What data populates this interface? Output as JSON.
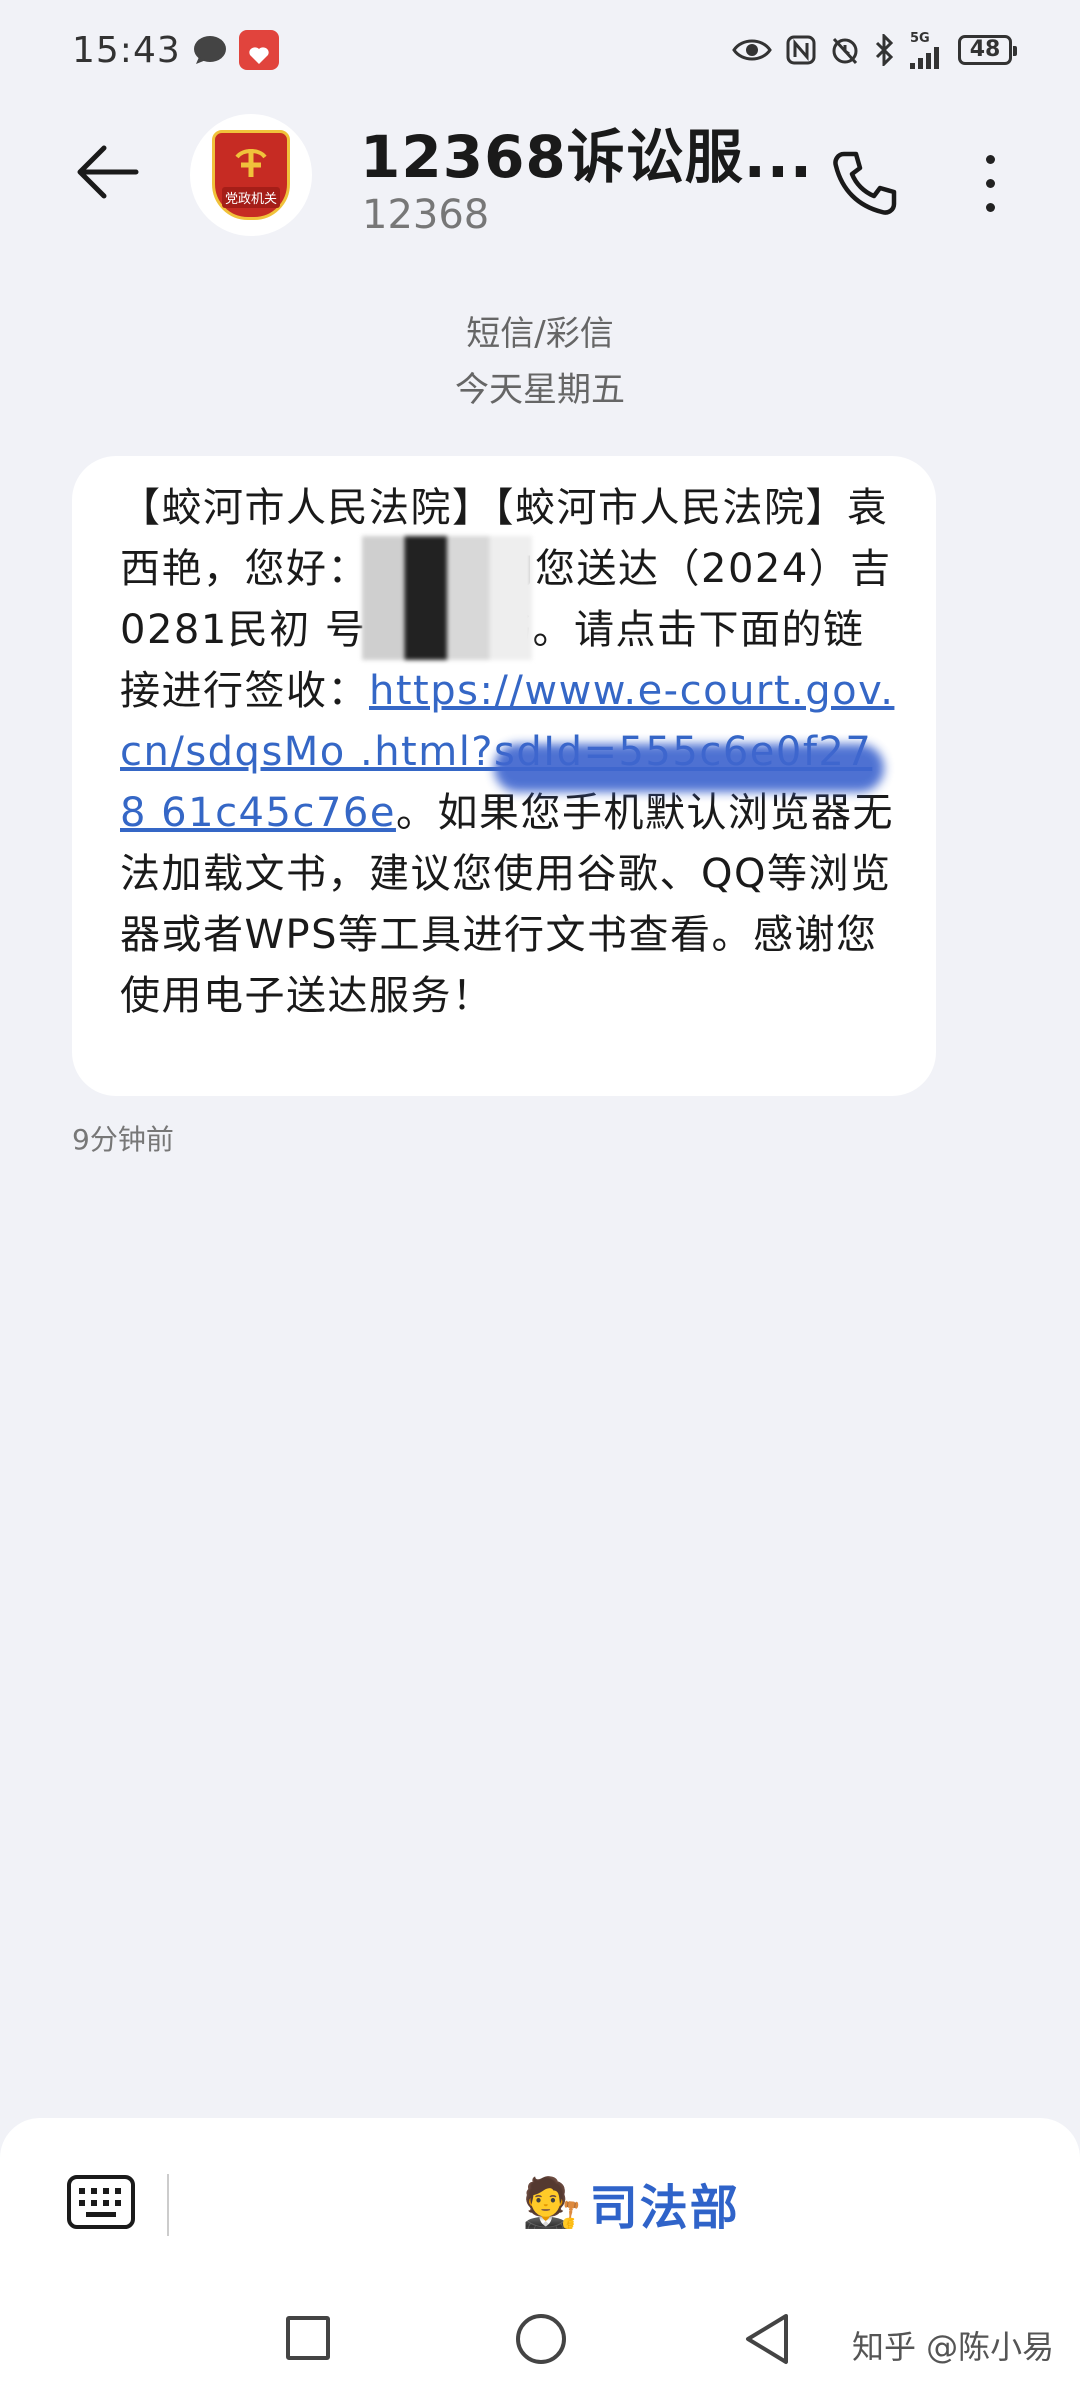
{
  "status_bar": {
    "time": "15:43",
    "battery_level": "48",
    "network_label": "5G",
    "icons": [
      "message-notification-icon",
      "app-notification-icon",
      "eye-icon",
      "nfc-icon",
      "silent-alarm-icon",
      "bluetooth-icon",
      "signal-icon",
      "battery-icon"
    ]
  },
  "header": {
    "contact_name": "12368诉讼服...",
    "contact_number": "12368",
    "avatar_badge": "党政机关",
    "icons": [
      "back-arrow-icon",
      "phone-icon",
      "more-vertical-icon"
    ]
  },
  "conversation": {
    "type_label": "短信/彩信",
    "date_label": "今天星期五"
  },
  "message": {
    "text_part1": "【蛟河市人民法院】【蛟河市人民法院】袁西艳，您好：你方法向您送达（2024）吉0281民初 号相关文书。请点击下面的链接进行签收：",
    "link": "https://www.e-court.gov.cn/sdqsMo                 .html?sdId=555c6e0f278                           61c45c76e",
    "text_part2": "。如果您手机默认浏览器无法加载文书，建议您使用谷歌、QQ等浏览器或者WPS等工具进行文书查看。感谢您使用电子送达服务！",
    "time": "9分钟前"
  },
  "composer": {
    "quick_reply_emoji": "🧑‍⚖️",
    "quick_reply_label": "司法部",
    "icons": [
      "keyboard-icon"
    ]
  },
  "nav_bar": {
    "icons": [
      "recents-square-icon",
      "home-circle-icon",
      "back-triangle-icon"
    ],
    "watermark": "知乎 @陈小易"
  },
  "colors": {
    "background": "#f1f2f7",
    "bubble": "#ffffff",
    "link": "#3567c6",
    "quick_reply": "#2f63c9",
    "avatar_red": "#c62b23"
  }
}
